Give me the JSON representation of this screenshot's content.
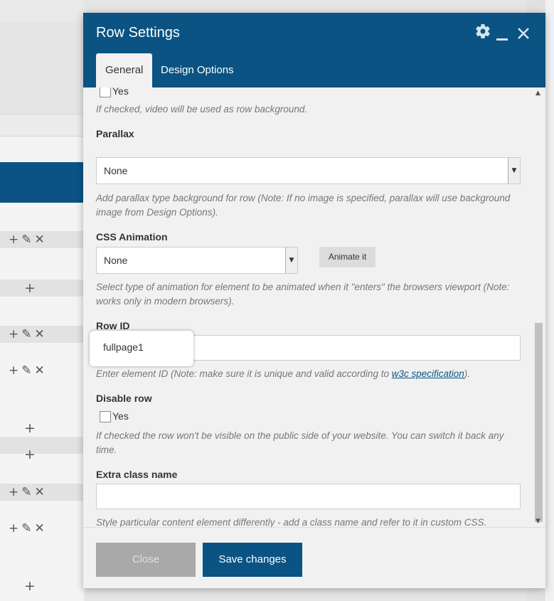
{
  "modal": {
    "title": "Row Settings",
    "header_icons": {
      "settings": "gear-icon",
      "minimize": "minimize-icon",
      "close": "close-icon"
    },
    "tabs": [
      {
        "label": "General",
        "active": true
      },
      {
        "label": "Design Options",
        "active": false
      }
    ]
  },
  "form": {
    "video_bg": {
      "checkbox_label": "Yes",
      "checked": false,
      "help": "If checked, video will be used as row background."
    },
    "parallax": {
      "label": "Parallax",
      "selected": "None",
      "help": "Add parallax type background for row (Note: If no image is specified, parallax will use background image from Design Options)."
    },
    "css_animation": {
      "label": "CSS Animation",
      "selected": "None",
      "animate_button": "Animate it",
      "help": "Select type of animation for element to be animated when it \"enters\" the browsers viewport (Note: works only in modern browsers)."
    },
    "row_id": {
      "label": "Row ID",
      "value": "fullpage1",
      "help_before": "Enter element ID (Note: make sure it is unique and valid according to ",
      "help_link": "w3c specification",
      "help_after": ")."
    },
    "disable_row": {
      "label": "Disable row",
      "checkbox_label": "Yes",
      "checked": false,
      "help": "If checked the row won't be visible on the public side of your website. You can switch it back any time."
    },
    "extra_class": {
      "label": "Extra class name",
      "value": "",
      "help": "Style particular content element differently - add a class name and refer to it in custom CSS."
    }
  },
  "footer": {
    "close_label": "Close",
    "save_label": "Save changes"
  },
  "colors": {
    "brand": "#0a5383",
    "panel": "#f1f1f1",
    "disabled": "#a9a9a9"
  }
}
